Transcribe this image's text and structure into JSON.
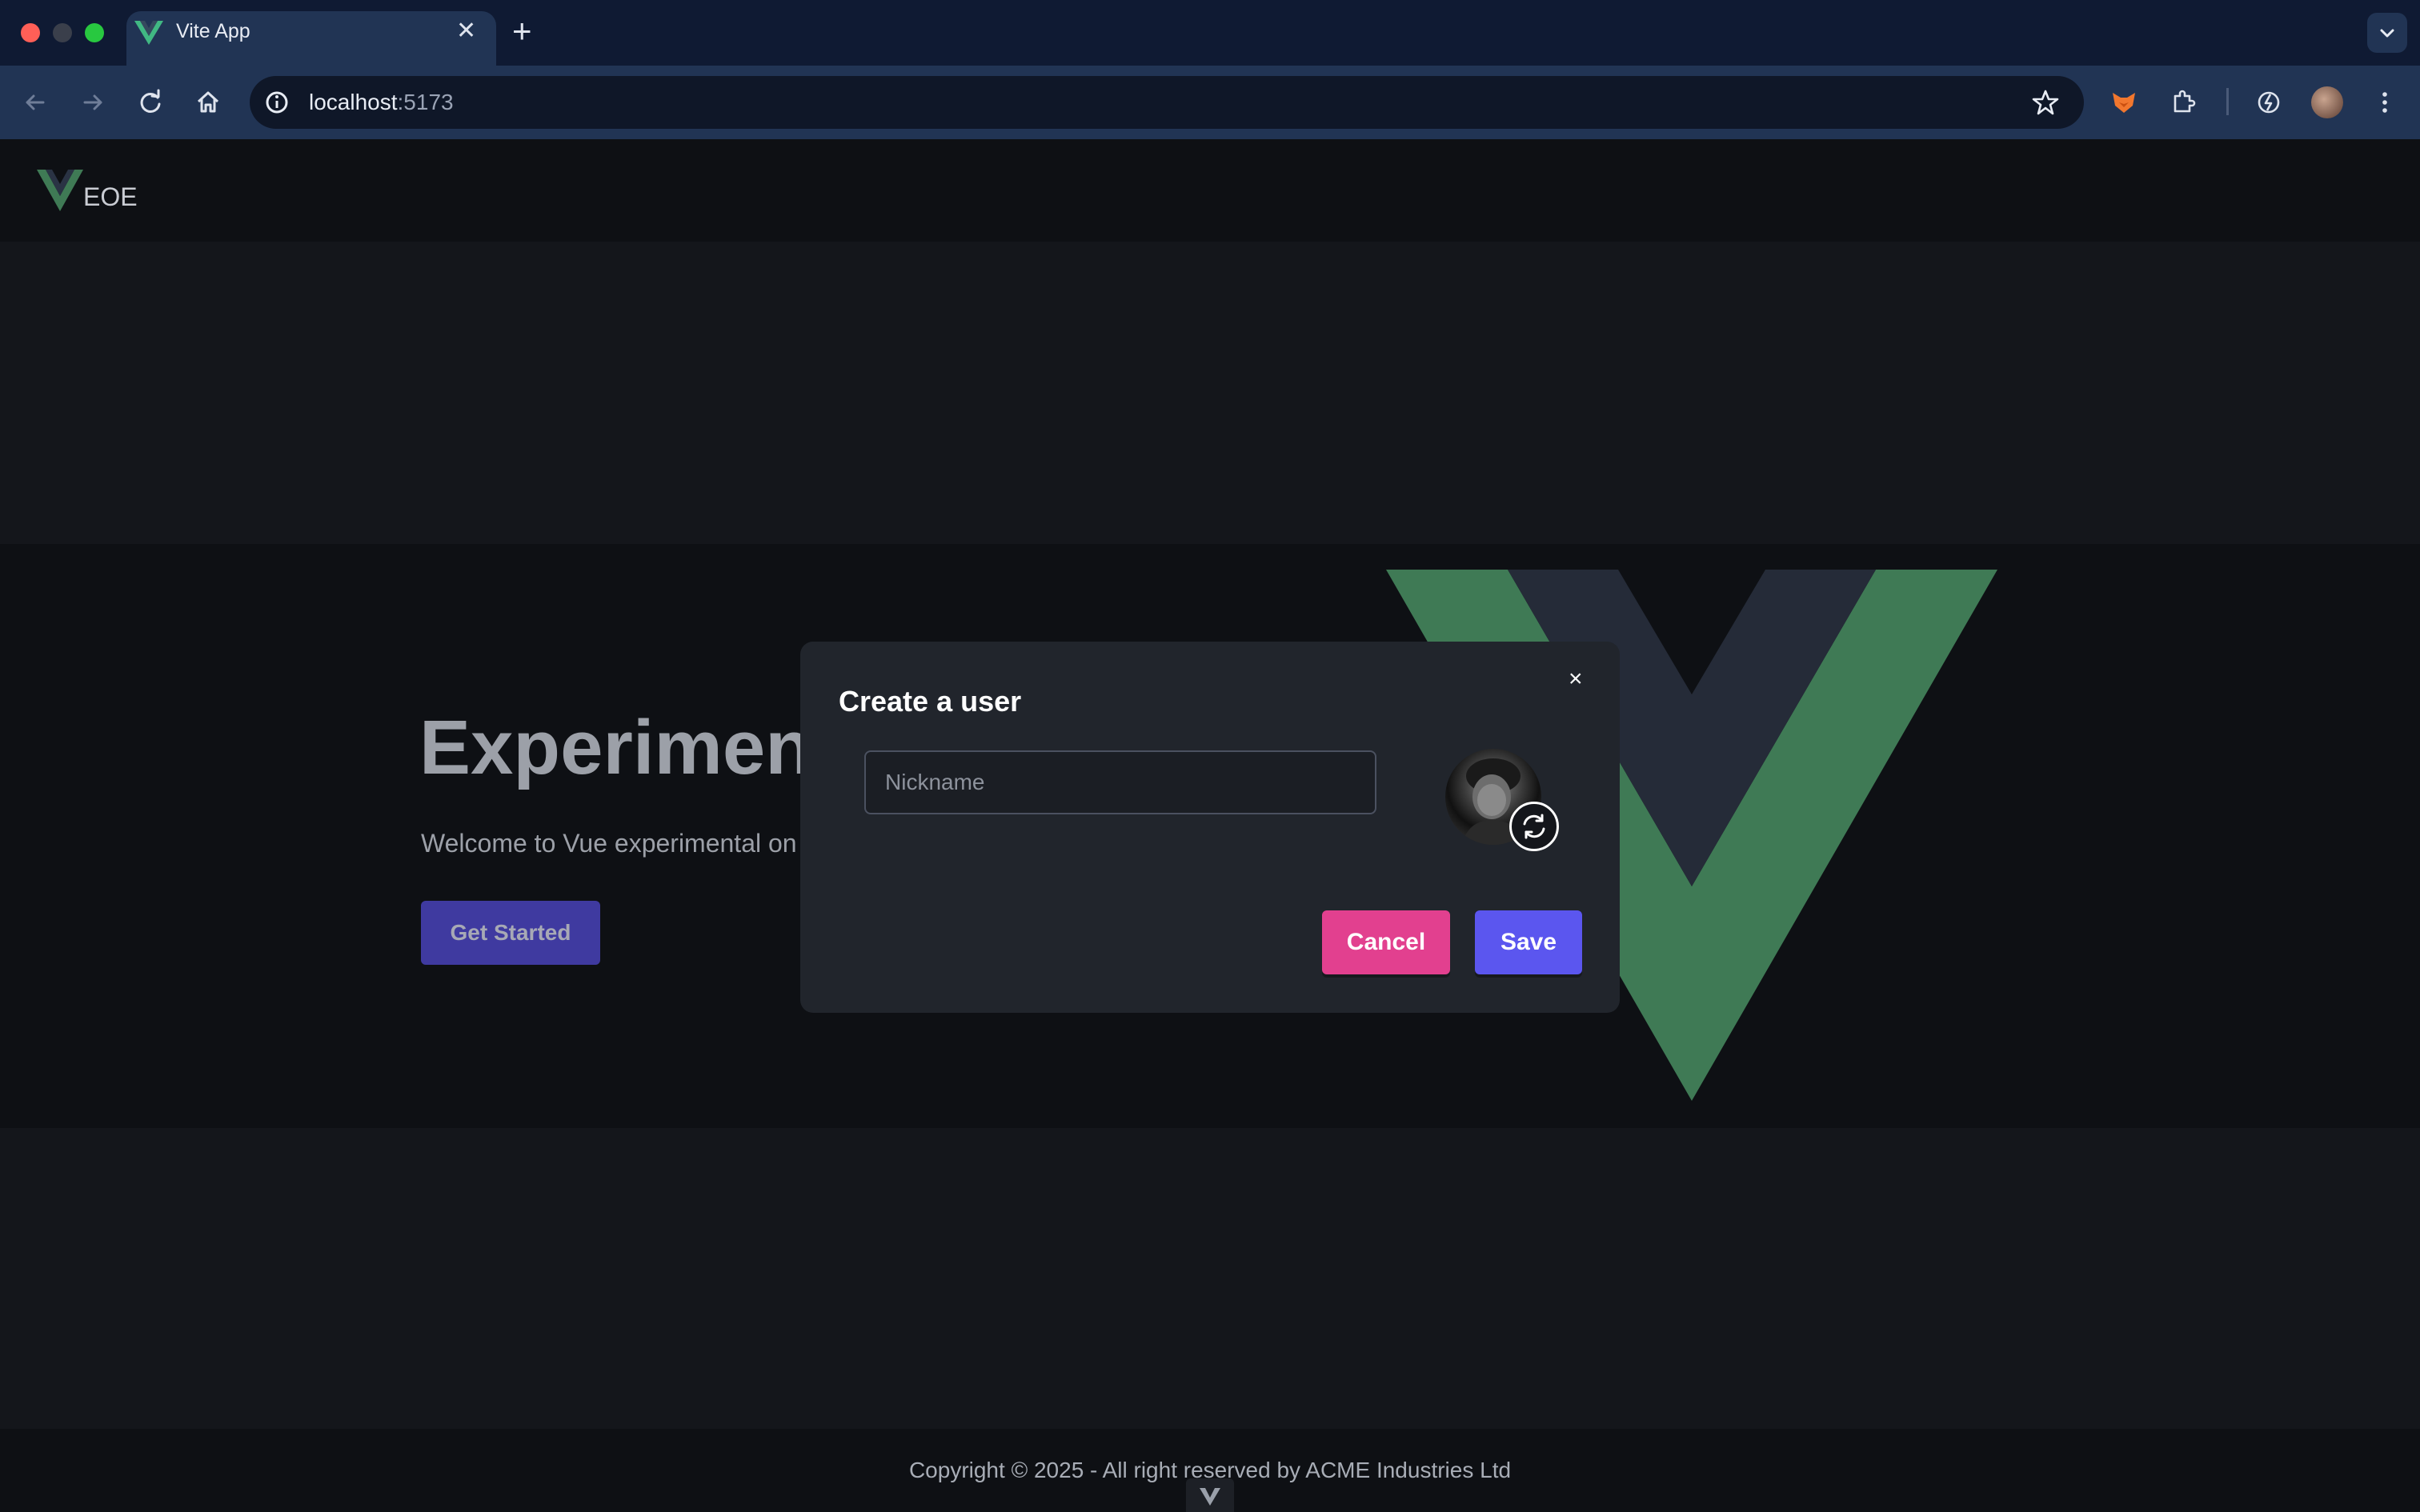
{
  "browser": {
    "tab_title": "Vite App",
    "url_host": "localhost",
    "url_port": ":5173"
  },
  "header": {
    "logo_text": "EOE"
  },
  "hero": {
    "title": "Experiment",
    "subtitle": "Welcome to Vue experimental on",
    "cta_label": "Get Started"
  },
  "modal": {
    "title": "Create a user",
    "close_icon": "×",
    "nickname_placeholder": "Nickname",
    "cancel_label": "Cancel",
    "save_label": "Save"
  },
  "footer": {
    "copyright": "Copyright © 2025 - All right reserved by ACME Industries Ltd"
  },
  "colors": {
    "brand_green": "#3f7a55",
    "cancel": "#e2408f",
    "save": "#5b56ef"
  }
}
